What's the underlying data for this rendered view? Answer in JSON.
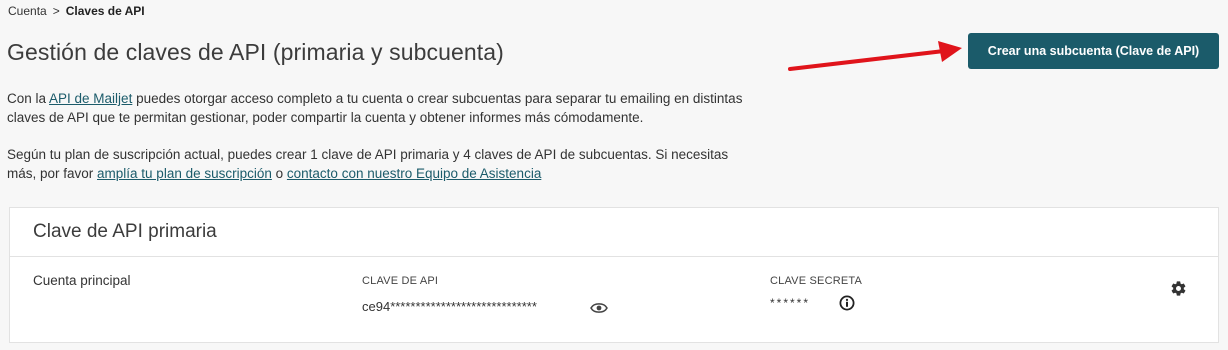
{
  "breadcrumb": {
    "parent": "Cuenta",
    "separator": ">",
    "current": "Claves de API"
  },
  "page": {
    "title": "Gestión de claves de API (primaria y subcuenta)"
  },
  "actions": {
    "create_subaccount_label": "Crear una subcuenta (Clave de API)"
  },
  "intro": {
    "p1_prefix": "Con la ",
    "p1_link": "API de Mailjet",
    "p1_suffix": " puedes otorgar acceso completo a tu cuenta o crear subcuentas para separar tu emailing en distintas claves de API que te permitan gestionar, poder compartir la cuenta y obtener informes más cómodamente.",
    "p2_prefix": "Según tu plan de suscripción actual, puedes crear 1 clave de API primaria y 4 claves de API de subcuentas. Si necesitas más, por favor ",
    "p2_link1": "amplía tu plan de suscripción",
    "p2_mid": " o ",
    "p2_link2": "contacto con nuestro Equipo de Asistencia"
  },
  "primary_key": {
    "card_title": "Clave de API primaria",
    "account_label": "Cuenta principal",
    "api_key_heading": "CLAVE DE API",
    "api_key_value": "ce94*****************************",
    "secret_heading": "CLAVE SECRETA",
    "secret_value": "******"
  },
  "icons": {
    "reveal": "eye-icon",
    "info": "info-icon",
    "settings": "gear-icon"
  },
  "colors": {
    "accent": "#1b5b6a",
    "annotation_arrow": "#e0141b"
  }
}
